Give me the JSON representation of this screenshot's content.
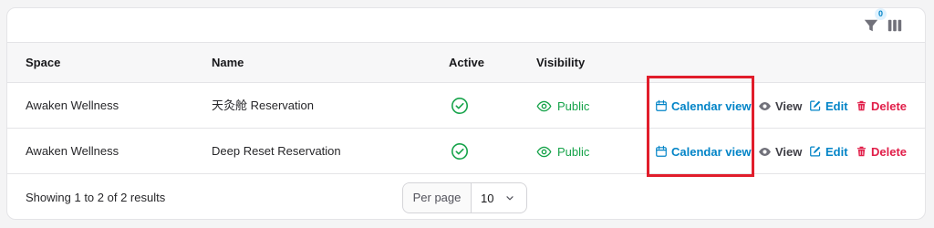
{
  "toolbar": {
    "filter_icon": "filter-icon",
    "filter_count": "0",
    "columns_icon": "columns-icon"
  },
  "table": {
    "headers": {
      "space": "Space",
      "name": "Name",
      "active": "Active",
      "visibility": "Visibility"
    },
    "rows": [
      {
        "space": "Awaken Wellness",
        "name": "天灸舱 Reservation",
        "active": "check-circle-icon",
        "visibility": "Public"
      },
      {
        "space": "Awaken Wellness",
        "name": "Deep Reset Reservation",
        "active": "check-circle-icon",
        "visibility": "Public"
      }
    ],
    "actions": {
      "calendar": "Calendar view",
      "view": "View",
      "edit": "Edit",
      "delete": "Delete"
    }
  },
  "footer": {
    "summary": "Showing 1 to 2 of 2 results",
    "per_page_label": "Per page",
    "per_page_value": "10"
  },
  "colors": {
    "primary": "#0284c7",
    "success": "#16a34a",
    "danger": "#e11d48",
    "highlight": "#e11d2b"
  }
}
